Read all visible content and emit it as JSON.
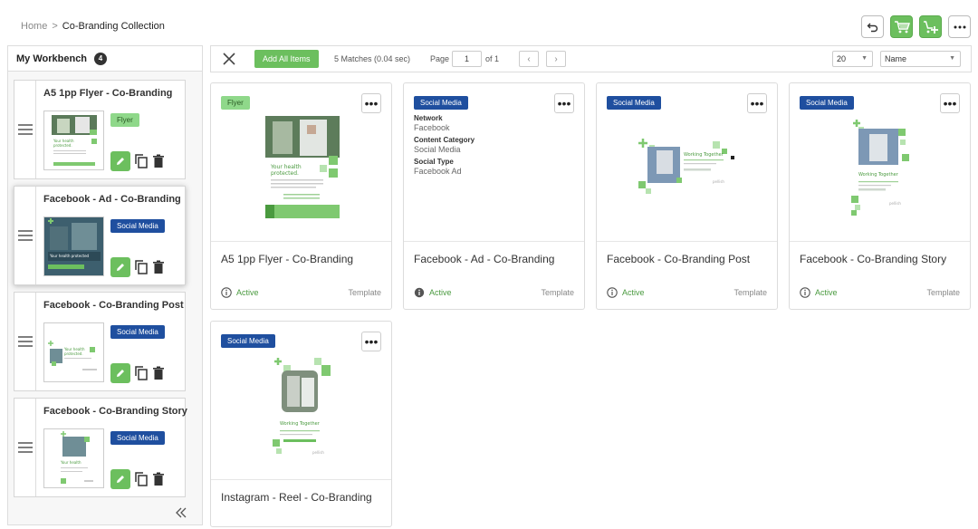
{
  "breadcrumb": {
    "home": "Home",
    "separator": ">",
    "current": "Co-Branding Collection"
  },
  "top_actions": [
    "undo-icon",
    "cart-icon",
    "cart-add-icon",
    "more-icon"
  ],
  "sidebar": {
    "title": "My Workbench",
    "count": "4",
    "items": [
      {
        "title": "A5 1pp Flyer - Co-Branding",
        "tag": "Flyer"
      },
      {
        "title": "Facebook - Ad - Co-Branding",
        "tag": "Social Media"
      },
      {
        "title": "Facebook - Co-Branding Post",
        "tag": "Social Media"
      },
      {
        "title": "Facebook - Co-Branding Story",
        "tag": "Social Media"
      }
    ]
  },
  "toolbar": {
    "add_all": "Add All Items",
    "matches": "5 Matches (0.04 sec)",
    "page_label": "Page",
    "page_value": "1",
    "of_label": "of 1",
    "page_size": "20",
    "sort": "Name"
  },
  "cards": [
    {
      "title": "A5 1pp Flyer - Co-Branding",
      "tag": "Flyer",
      "status": "Active",
      "type": "Template"
    },
    {
      "title": "Facebook - Ad - Co-Branding",
      "tag": "Social Media",
      "status": "Active",
      "type": "Template",
      "meta": [
        {
          "key": "Network",
          "value": "Facebook"
        },
        {
          "key": "Content Category",
          "value": "Social Media"
        },
        {
          "key": "Social Type",
          "value": "Facebook Ad"
        }
      ]
    },
    {
      "title": "Facebook - Co-Branding Post",
      "tag": "Social Media",
      "status": "Active",
      "type": "Template"
    },
    {
      "title": "Facebook - Co-Branding Story",
      "tag": "Social Media",
      "status": "Active",
      "type": "Template"
    },
    {
      "title": "Instagram - Reel - Co-Branding",
      "tag": "Social Media"
    }
  ],
  "colors": {
    "accent_green": "#6cbf5e",
    "social_blue": "#1f4f9f",
    "flyer_green": "#8fd88a"
  }
}
